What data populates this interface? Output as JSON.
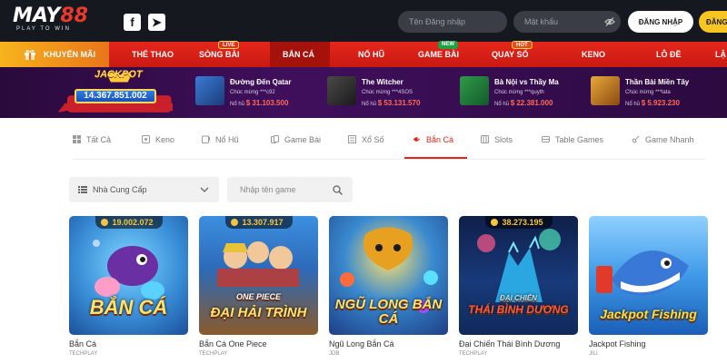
{
  "header": {
    "logo_main_a": "MAY",
    "logo_main_b": "88",
    "logo_tagline": "PLAY TO WIN",
    "social": [
      "f",
      "➤"
    ],
    "username_placeholder": "Tên Đăng nhập",
    "password_placeholder": "Mật khẩu",
    "login_label": "ĐĂNG NHẬP",
    "register_label": "ĐĂNG"
  },
  "nav": {
    "promo_label": "KHUYẾN MÃI",
    "items": [
      "THỂ THAO",
      "SÒNG BÀI",
      "BẮN CÁ",
      "NỔ HŨ",
      "GAME BÀI",
      "QUAY SỐ",
      "KENO",
      "LÔ ĐỀ",
      "LẬ"
    ],
    "active": "BẮN CÁ",
    "badges": {
      "live": "LIVE",
      "new": "NEW",
      "hot": "HOT"
    }
  },
  "jackpot": {
    "title": "JACKPOT",
    "amount": "14.367.851.002",
    "winners": [
      {
        "game": "Đường Đến Qatar",
        "user_prefix": "Chúc mừng",
        "user": "***c92",
        "amount_prefix": "Nổ hũ",
        "amount": "$ 31.103.500"
      },
      {
        "game": "The Witcher",
        "user_prefix": "Chúc mừng",
        "user": "***4SOS",
        "amount_prefix": "Nổ hũ",
        "amount": "$ 53.131.570"
      },
      {
        "game": "Bà Nội vs Thầy Ma",
        "user_prefix": "Chúc mừng",
        "user": "***quyth",
        "amount_prefix": "Nổ hũ",
        "amount": "$ 22.381.000"
      },
      {
        "game": "Thần Bài Miền Tây",
        "user_prefix": "Chúc mừng",
        "user": "***lata",
        "amount_prefix": "Nổ hũ",
        "amount": "$ 5.923.230"
      }
    ]
  },
  "tabs": {
    "items": [
      "Tất Cả",
      "Keno",
      "Nổ Hũ",
      "Game Bài",
      "Xổ Số",
      "Bắn Cá",
      "Slots",
      "Table Games",
      "Game Nhanh"
    ],
    "active": "Bắn Cá"
  },
  "filters": {
    "provider_label": "Nhà Cung Cấp",
    "search_placeholder": "Nhập tên game"
  },
  "games": [
    {
      "name": "Bắn Cá",
      "provider": "TECHPLAY",
      "jackpot": "19.002.072",
      "art_text": "BẮN CÁ"
    },
    {
      "name": "Bắn Cá One Piece",
      "provider": "TECHPLAY",
      "jackpot": "13.307.917",
      "art_text": "ĐẠI HẢI TRÌNH",
      "art_sub": "ONE PIECE"
    },
    {
      "name": "Ngũ Long Bắn Cá",
      "provider": "JDB",
      "jackpot": "",
      "art_text": "NGŨ LONG BẮN CÁ"
    },
    {
      "name": "Đại Chiến Thái Bình Dương",
      "provider": "TECHPLAY",
      "jackpot": "38.273.195",
      "art_text": "THÁI BÌNH DƯƠNG",
      "art_sub": "ĐẠI CHIẾN"
    },
    {
      "name": "Jackpot Fishing",
      "provider": "JILI",
      "jackpot": "",
      "art_text": "Jackpot Fishing"
    }
  ],
  "colors": {
    "brand_red": "#e2261c",
    "header_bg": "#16181f",
    "promo_orange": "#f7b41c",
    "register_yellow": "#f7c623",
    "jackpot_purple": "#3f0f5c"
  }
}
